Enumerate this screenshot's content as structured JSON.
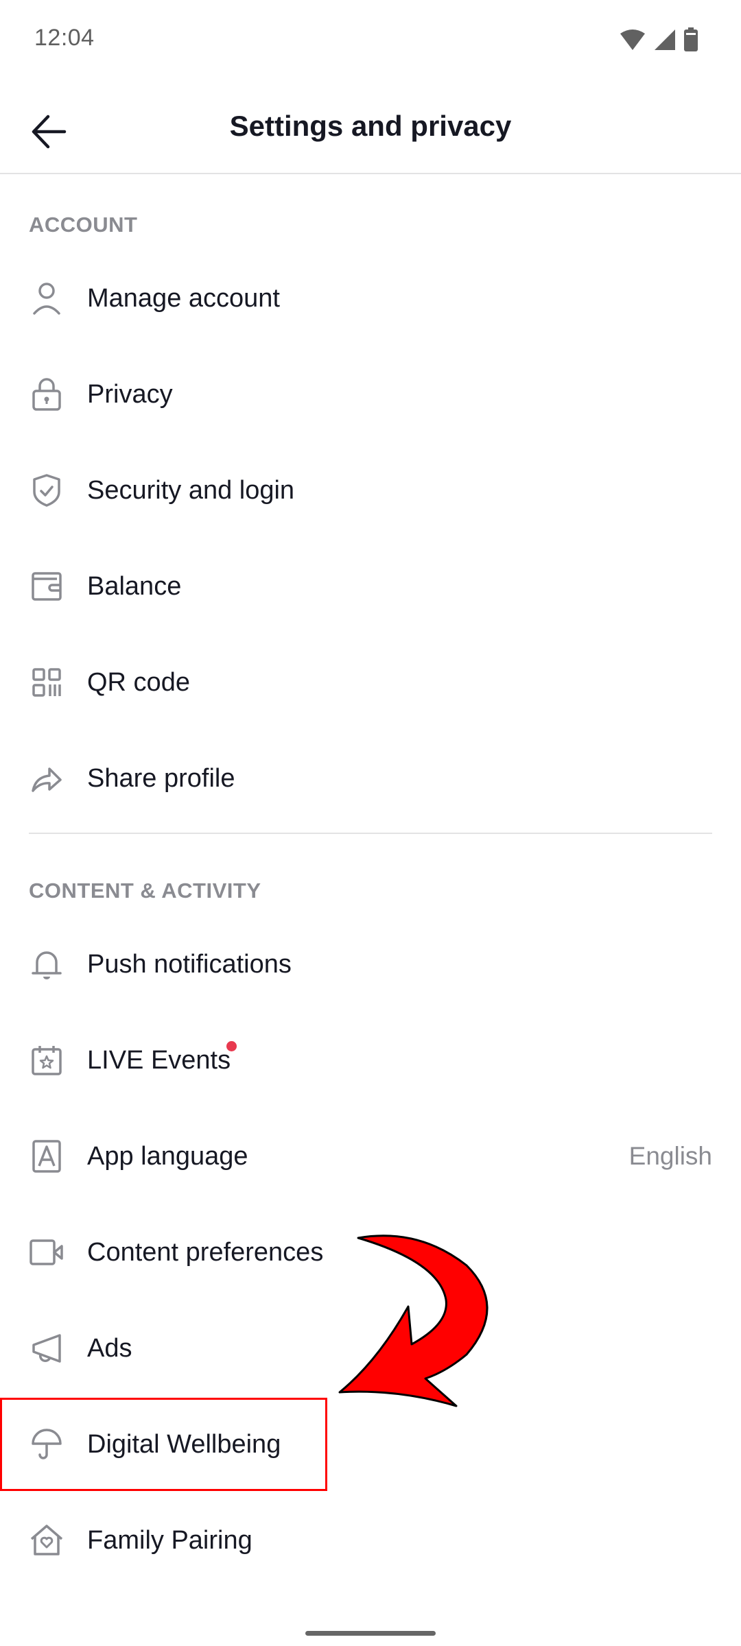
{
  "status_bar": {
    "time": "12:04",
    "icons": [
      "wifi-icon",
      "cellular-signal-icon",
      "battery-icon"
    ]
  },
  "header": {
    "back_icon": "arrow-left-icon",
    "title": "Settings and privacy"
  },
  "sections": [
    {
      "title": "ACCOUNT",
      "items": [
        {
          "label": "Manage account",
          "icon": "person-icon"
        },
        {
          "label": "Privacy",
          "icon": "lock-icon"
        },
        {
          "label": "Security and login",
          "icon": "shield-check-icon"
        },
        {
          "label": "Balance",
          "icon": "wallet-icon"
        },
        {
          "label": "QR code",
          "icon": "qr-code-icon"
        },
        {
          "label": "Share profile",
          "icon": "share-arrow-icon"
        }
      ]
    },
    {
      "title": "CONTENT & ACTIVITY",
      "items": [
        {
          "label": "Push notifications",
          "icon": "bell-icon"
        },
        {
          "label": "LIVE Events",
          "icon": "calendar-star-icon",
          "badge": "new-dot"
        },
        {
          "label": "App language",
          "icon": "letter-a-box-icon",
          "value": "English"
        },
        {
          "label": "Content preferences",
          "icon": "video-camera-icon"
        },
        {
          "label": "Ads",
          "icon": "megaphone-icon"
        },
        {
          "label": "Digital Wellbeing",
          "icon": "umbrella-icon",
          "highlighted": true
        },
        {
          "label": "Family Pairing",
          "icon": "house-heart-icon"
        }
      ]
    }
  ],
  "annotation": {
    "type": "red-curved-arrow",
    "target": "Digital Wellbeing",
    "color": "#ff0000"
  },
  "colors": {
    "text_primary": "#161823",
    "text_secondary": "#8a8b91",
    "icon": "#8a8b91",
    "badge_dot": "#e8394f",
    "highlight": "#ff0000"
  }
}
